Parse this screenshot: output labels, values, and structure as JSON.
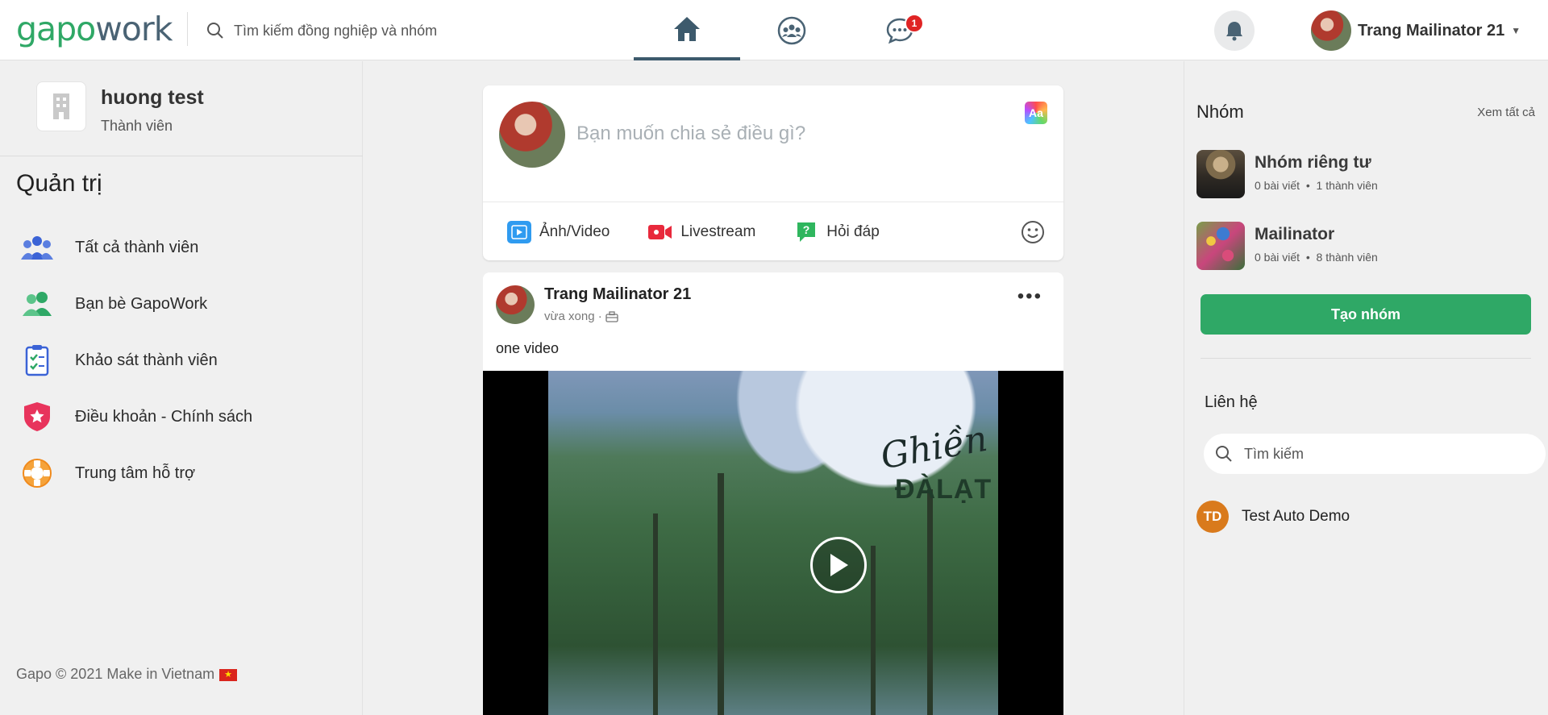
{
  "header": {
    "logo_part1": "gapo",
    "logo_part2": "work",
    "search_placeholder": "Tìm kiếm đồng nghiệp và nhóm",
    "chat_badge": "1",
    "user_name": "Trang Mailinator 21"
  },
  "left": {
    "org_name": "huong test",
    "org_role": "Thành viên",
    "admin_title": "Quản trị",
    "menu": [
      {
        "label": "Tất cả thành viên",
        "icon": "members-icon"
      },
      {
        "label": "Bạn bè GapoWork",
        "icon": "friends-icon"
      },
      {
        "label": "Khảo sát thành viên",
        "icon": "survey-icon"
      },
      {
        "label": "Điều khoản - Chính sách",
        "icon": "policy-shield-icon"
      },
      {
        "label": "Trung tâm hỗ trợ",
        "icon": "support-lifebuoy-icon"
      }
    ],
    "footer": "Gapo © 2021 Make in Vietnam"
  },
  "composer": {
    "placeholder": "Bạn muốn chia sẻ điều gì?",
    "aa_label": "Aa",
    "actions": [
      {
        "label": "Ảnh/Video"
      },
      {
        "label": "Livestream"
      },
      {
        "label": "Hỏi đáp"
      }
    ]
  },
  "post": {
    "author": "Trang Mailinator 21",
    "time": "vừa xong ·",
    "text": "one video",
    "video_overlay_1": "Ghiền",
    "video_overlay_2": "ĐÀLẠT"
  },
  "right": {
    "groups_title": "Nhóm",
    "see_all": "Xem tất cả",
    "groups": [
      {
        "name": "Nhóm riêng tư",
        "posts": "0 bài viết",
        "members": "1 thành viên"
      },
      {
        "name": "Mailinator",
        "posts": "0 bài viết",
        "members": "8 thành viên"
      }
    ],
    "create_group": "Tạo nhóm",
    "contacts_title": "Liên hệ",
    "contact_search_placeholder": "Tìm kiếm",
    "contacts": [
      {
        "initials": "TD",
        "name": "Test Auto Demo"
      }
    ]
  },
  "colors": {
    "brand_green": "#2fa866",
    "brand_dark": "#4a6374",
    "badge_red": "#e02424",
    "contact_orange": "#d97a1c"
  }
}
